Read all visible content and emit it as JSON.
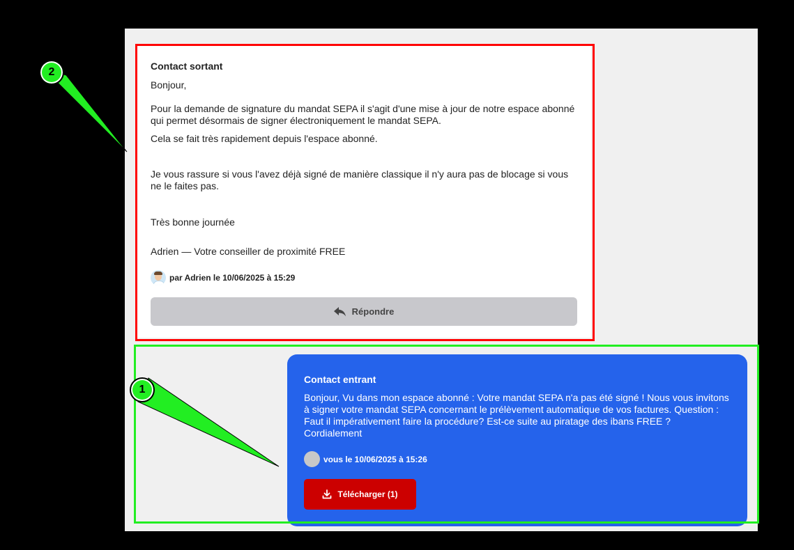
{
  "outgoing": {
    "title": "Contact sortant",
    "greeting": "Bonjour,",
    "p1": "Pour la demande de signature du mandat SEPA il s'agit d'une mise à jour de notre espace abonné qui permet désormais de signer électroniquement le mandat SEPA.",
    "p2": "Cela se fait très rapidement depuis l'espace abonné.",
    "p3": "Je vous rassure si vous l'avez déjà signé de manière classique il n'y aura pas de blocage si vous ne le faites pas.",
    "closing": "Très bonne journée",
    "signature": "Adrien — Votre conseiller de proximité FREE",
    "meta": "par Adrien le 10/06/2025 à 15:29",
    "reply_label": "Répondre"
  },
  "incoming": {
    "title": "Contact entrant",
    "body": "Bonjour, Vu dans mon espace abonné : Votre mandat SEPA n'a pas été signé ! Nous vous invitons à signer votre mandat SEPA concernant le prélèvement automatique de vos factures. Question : Faut il impérativement faire la procédure? Est-ce suite au piratage des ibans FREE ? Cordialement",
    "meta": "vous le 10/06/2025 à 15:26",
    "download_label": "Télécharger (1)"
  },
  "annotations": {
    "marker_1": "1",
    "marker_2": "2"
  },
  "colors": {
    "incoming_bg": "#2563eb",
    "download_bg": "#cc0000",
    "reply_bg": "#c8c8cc",
    "annotation_green": "#22ee22",
    "annotation_red": "#ff0000"
  },
  "icons": {
    "reply": "reply-arrow-icon",
    "download": "download-icon"
  }
}
